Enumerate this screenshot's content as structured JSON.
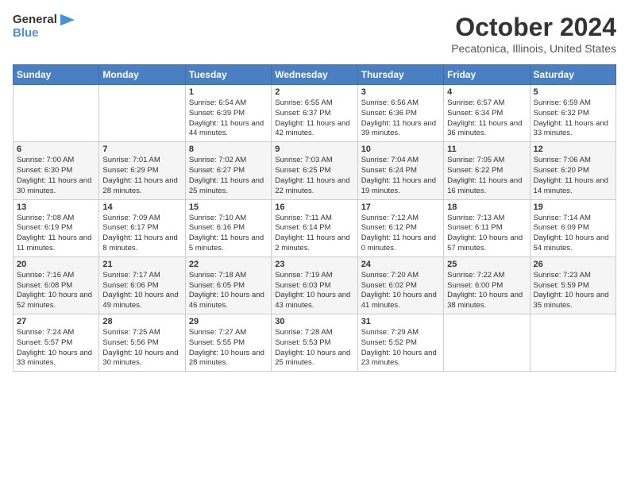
{
  "logo": {
    "line1": "General",
    "line2": "Blue"
  },
  "title": "October 2024",
  "location": "Pecatonica, Illinois, United States",
  "weekdays": [
    "Sunday",
    "Monday",
    "Tuesday",
    "Wednesday",
    "Thursday",
    "Friday",
    "Saturday"
  ],
  "weeks": [
    [
      {
        "day": null
      },
      {
        "day": null
      },
      {
        "day": "1",
        "sunrise": "Sunrise: 6:54 AM",
        "sunset": "Sunset: 6:39 PM",
        "daylight": "Daylight: 11 hours and 44 minutes."
      },
      {
        "day": "2",
        "sunrise": "Sunrise: 6:55 AM",
        "sunset": "Sunset: 6:37 PM",
        "daylight": "Daylight: 11 hours and 42 minutes."
      },
      {
        "day": "3",
        "sunrise": "Sunrise: 6:56 AM",
        "sunset": "Sunset: 6:36 PM",
        "daylight": "Daylight: 11 hours and 39 minutes."
      },
      {
        "day": "4",
        "sunrise": "Sunrise: 6:57 AM",
        "sunset": "Sunset: 6:34 PM",
        "daylight": "Daylight: 11 hours and 36 minutes."
      },
      {
        "day": "5",
        "sunrise": "Sunrise: 6:59 AM",
        "sunset": "Sunset: 6:32 PM",
        "daylight": "Daylight: 11 hours and 33 minutes."
      }
    ],
    [
      {
        "day": "6",
        "sunrise": "Sunrise: 7:00 AM",
        "sunset": "Sunset: 6:30 PM",
        "daylight": "Daylight: 11 hours and 30 minutes."
      },
      {
        "day": "7",
        "sunrise": "Sunrise: 7:01 AM",
        "sunset": "Sunset: 6:29 PM",
        "daylight": "Daylight: 11 hours and 28 minutes."
      },
      {
        "day": "8",
        "sunrise": "Sunrise: 7:02 AM",
        "sunset": "Sunset: 6:27 PM",
        "daylight": "Daylight: 11 hours and 25 minutes."
      },
      {
        "day": "9",
        "sunrise": "Sunrise: 7:03 AM",
        "sunset": "Sunset: 6:25 PM",
        "daylight": "Daylight: 11 hours and 22 minutes."
      },
      {
        "day": "10",
        "sunrise": "Sunrise: 7:04 AM",
        "sunset": "Sunset: 6:24 PM",
        "daylight": "Daylight: 11 hours and 19 minutes."
      },
      {
        "day": "11",
        "sunrise": "Sunrise: 7:05 AM",
        "sunset": "Sunset: 6:22 PM",
        "daylight": "Daylight: 11 hours and 16 minutes."
      },
      {
        "day": "12",
        "sunrise": "Sunrise: 7:06 AM",
        "sunset": "Sunset: 6:20 PM",
        "daylight": "Daylight: 11 hours and 14 minutes."
      }
    ],
    [
      {
        "day": "13",
        "sunrise": "Sunrise: 7:08 AM",
        "sunset": "Sunset: 6:19 PM",
        "daylight": "Daylight: 11 hours and 11 minutes."
      },
      {
        "day": "14",
        "sunrise": "Sunrise: 7:09 AM",
        "sunset": "Sunset: 6:17 PM",
        "daylight": "Daylight: 11 hours and 8 minutes."
      },
      {
        "day": "15",
        "sunrise": "Sunrise: 7:10 AM",
        "sunset": "Sunset: 6:16 PM",
        "daylight": "Daylight: 11 hours and 5 minutes."
      },
      {
        "day": "16",
        "sunrise": "Sunrise: 7:11 AM",
        "sunset": "Sunset: 6:14 PM",
        "daylight": "Daylight: 11 hours and 2 minutes."
      },
      {
        "day": "17",
        "sunrise": "Sunrise: 7:12 AM",
        "sunset": "Sunset: 6:12 PM",
        "daylight": "Daylight: 11 hours and 0 minutes."
      },
      {
        "day": "18",
        "sunrise": "Sunrise: 7:13 AM",
        "sunset": "Sunset: 6:11 PM",
        "daylight": "Daylight: 10 hours and 57 minutes."
      },
      {
        "day": "19",
        "sunrise": "Sunrise: 7:14 AM",
        "sunset": "Sunset: 6:09 PM",
        "daylight": "Daylight: 10 hours and 54 minutes."
      }
    ],
    [
      {
        "day": "20",
        "sunrise": "Sunrise: 7:16 AM",
        "sunset": "Sunset: 6:08 PM",
        "daylight": "Daylight: 10 hours and 52 minutes."
      },
      {
        "day": "21",
        "sunrise": "Sunrise: 7:17 AM",
        "sunset": "Sunset: 6:06 PM",
        "daylight": "Daylight: 10 hours and 49 minutes."
      },
      {
        "day": "22",
        "sunrise": "Sunrise: 7:18 AM",
        "sunset": "Sunset: 6:05 PM",
        "daylight": "Daylight: 10 hours and 46 minutes."
      },
      {
        "day": "23",
        "sunrise": "Sunrise: 7:19 AM",
        "sunset": "Sunset: 6:03 PM",
        "daylight": "Daylight: 10 hours and 43 minutes."
      },
      {
        "day": "24",
        "sunrise": "Sunrise: 7:20 AM",
        "sunset": "Sunset: 6:02 PM",
        "daylight": "Daylight: 10 hours and 41 minutes."
      },
      {
        "day": "25",
        "sunrise": "Sunrise: 7:22 AM",
        "sunset": "Sunset: 6:00 PM",
        "daylight": "Daylight: 10 hours and 38 minutes."
      },
      {
        "day": "26",
        "sunrise": "Sunrise: 7:23 AM",
        "sunset": "Sunset: 5:59 PM",
        "daylight": "Daylight: 10 hours and 35 minutes."
      }
    ],
    [
      {
        "day": "27",
        "sunrise": "Sunrise: 7:24 AM",
        "sunset": "Sunset: 5:57 PM",
        "daylight": "Daylight: 10 hours and 33 minutes."
      },
      {
        "day": "28",
        "sunrise": "Sunrise: 7:25 AM",
        "sunset": "Sunset: 5:56 PM",
        "daylight": "Daylight: 10 hours and 30 minutes."
      },
      {
        "day": "29",
        "sunrise": "Sunrise: 7:27 AM",
        "sunset": "Sunset: 5:55 PM",
        "daylight": "Daylight: 10 hours and 28 minutes."
      },
      {
        "day": "30",
        "sunrise": "Sunrise: 7:28 AM",
        "sunset": "Sunset: 5:53 PM",
        "daylight": "Daylight: 10 hours and 25 minutes."
      },
      {
        "day": "31",
        "sunrise": "Sunrise: 7:29 AM",
        "sunset": "Sunset: 5:52 PM",
        "daylight": "Daylight: 10 hours and 23 minutes."
      },
      {
        "day": null
      },
      {
        "day": null
      }
    ]
  ]
}
